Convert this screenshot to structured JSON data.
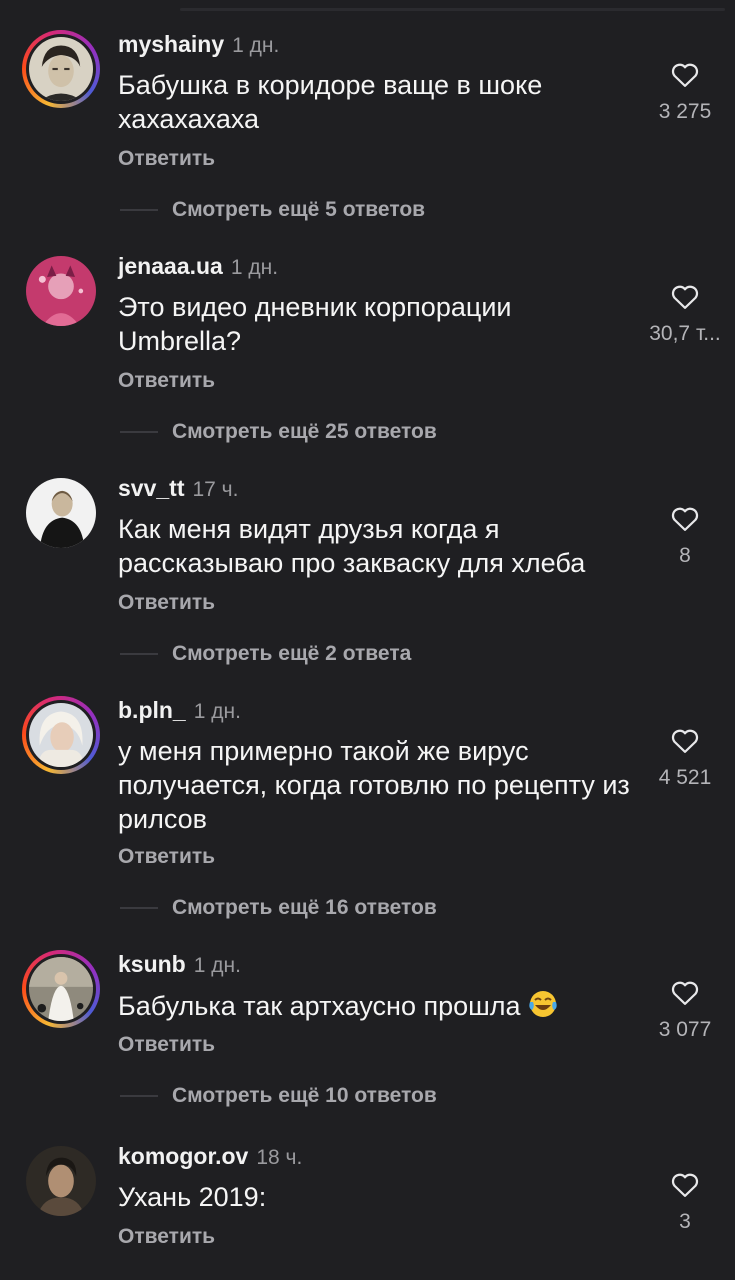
{
  "reply_label": "Ответить",
  "comments": [
    {
      "username": "myshainy",
      "time": "1 дн.",
      "text": "Бабушка в коридоре ваще в шоке хахахахаха",
      "likes": "3 275",
      "more_replies": "Смотреть ещё 5 ответов"
    },
    {
      "username": "jenaaa.ua",
      "time": "1 дн.",
      "text": "Это видео дневник корпорации Umbrella?",
      "likes": "30,7 т...",
      "more_replies": "Смотреть ещё 25 ответов"
    },
    {
      "username": "svv_tt",
      "time": "17 ч.",
      "text": "Как меня видят друзья когда я рассказываю про закваску для хлеба",
      "likes": "8",
      "more_replies": "Смотреть ещё 2 ответа"
    },
    {
      "username": "b.pln_",
      "time": "1 дн.",
      "text": "у меня примерно такой же вирус получается, когда готовлю по рецепту из рилсов",
      "likes": "4 521",
      "more_replies": "Смотреть ещё 16 ответов"
    },
    {
      "username": "ksunb",
      "time": "1 дн.",
      "text": "Бабулька так артхаусно прошла",
      "text_emoji": "tears-of-joy-emoji",
      "likes": "3 077",
      "more_replies": "Смотреть ещё 10 ответов"
    },
    {
      "username": "komogor.ov",
      "time": "18 ч.",
      "text": "Ухань 2019:",
      "likes": "3"
    }
  ],
  "icons": {
    "like": "heart-outline-icon"
  },
  "colors": {
    "background": "#1f1f22",
    "primary_text": "#f2f2f2",
    "secondary_text": "#a8a8ad",
    "story_ring": "#d62976"
  }
}
